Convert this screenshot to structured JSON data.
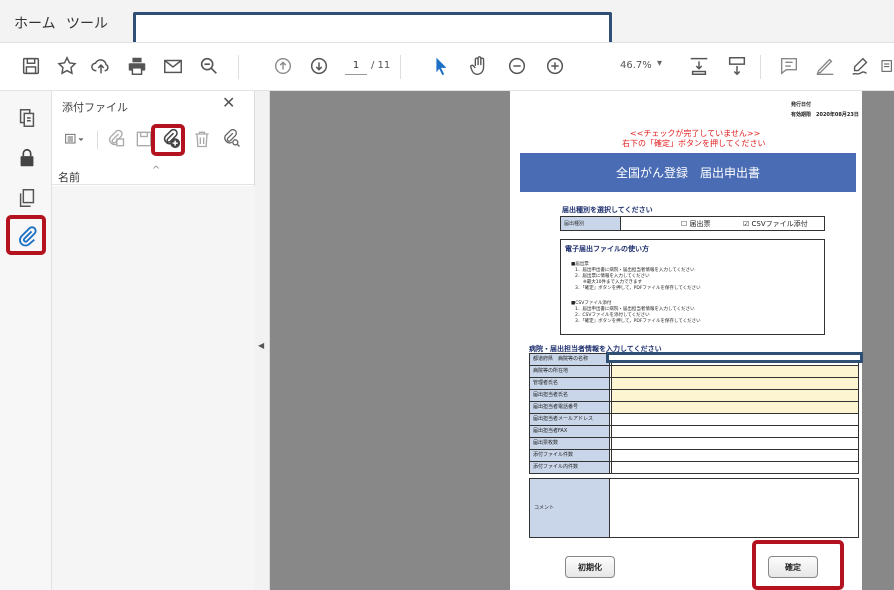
{
  "menu": {
    "home": "ホーム",
    "tools": "ツール"
  },
  "toolbar": {
    "page_current": "1",
    "page_total": "/ 11",
    "zoom": "46.7%",
    "zoom_arrow": "▾"
  },
  "panel": {
    "title": "添付ファイル",
    "close": "✕",
    "column_name": "名前",
    "sort_indicator": "^"
  },
  "splitter": {
    "arrow": "◀"
  },
  "document": {
    "issue_date_label": "発行日付",
    "valid_until_label": "有効期限",
    "valid_until_value": "2020年08月23日",
    "warning_line1": "<<チェックが完了していません>>",
    "warning_line2": "右下の「確定」ボタンを押してください",
    "form_title": "全国がん登録　届出申出書",
    "select_type_heading": "届出種別を選択してください",
    "type_label": "届出種別",
    "option_form": "☐ 届出票",
    "option_csv": "☑ CSVファイル添付",
    "howto_title": "電子届出ファイルの使い方",
    "howto_section1": "■届出票",
    "howto_s1_1": "1．届出申出書に病院・届出担当者情報を入力してください",
    "howto_s1_2": "2．届出票に情報を入力してください",
    "howto_s1_3": "※最大10件まで入力できます",
    "howto_s1_4": "3．「確定」ボタンを押して，PDFファイルを保存してください",
    "howto_section2": "■CSVファイル添付",
    "howto_s2_1": "1．届出申出書に病院・届出担当者情報を入力してください",
    "howto_s2_2": "2．CSVファイルを添付してください",
    "howto_s2_3": "3．「確定」ボタンを押して，PDFファイルを保存してください",
    "hospital_heading": "病院・届出担当者情報を入力してください",
    "rows": [
      {
        "label": "都道府県　病院等の名称",
        "color": "#ffffff"
      },
      {
        "label": "病院等の所在地",
        "color": "#fdf5d2"
      },
      {
        "label": "管理者氏名",
        "color": "#fdf5d2"
      },
      {
        "label": "届出担当者氏名",
        "color": "#fdf5d2"
      },
      {
        "label": "届出担当者電話番号",
        "color": "#fdf5d2"
      },
      {
        "label": "届出担当者メールアドレス",
        "color": "#ffffff"
      },
      {
        "label": "届出担当者FAX",
        "color": "#ffffff"
      },
      {
        "label": "届出票枚数",
        "color": "#ffffff"
      },
      {
        "label": "添付ファイル件数",
        "color": "#ffffff"
      },
      {
        "label": "添付ファイル内件数",
        "color": "#ffffff"
      }
    ],
    "comment_label": "コメント",
    "reset_button": "初期化",
    "confirm_button": "確定"
  },
  "colors": {
    "highlight_red": "#b4121e",
    "tab_border": "#2f4f75",
    "form_header_blue": "#4a6cb4",
    "label_blue": "#c9d6ea",
    "field_yellow": "#fdf5d2"
  }
}
